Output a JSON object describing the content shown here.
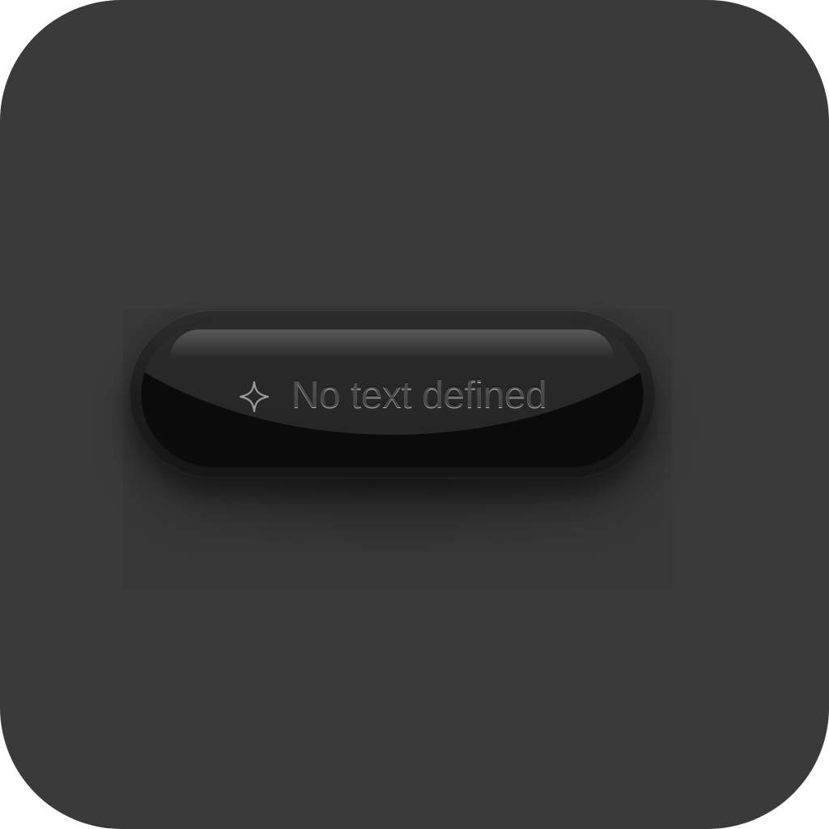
{
  "button": {
    "label": "No text defined",
    "icon": "sparkle-icon"
  },
  "colors": {
    "background": "#3a3a3a",
    "button_body": "#0b0b0b",
    "label_text": "#b9b9b9"
  }
}
